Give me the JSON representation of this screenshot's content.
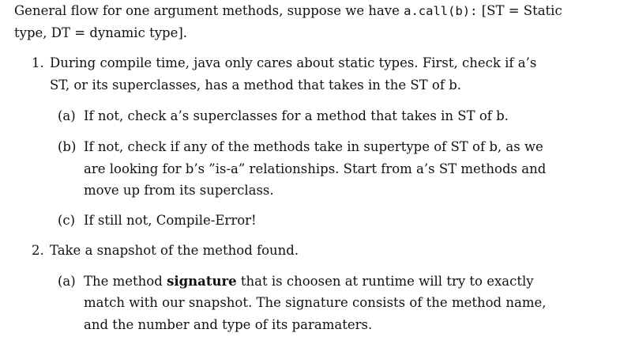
{
  "intro": {
    "line1_prefix": "General flow for one argument methods, suppose we have ",
    "line1_code": "a.call(b):",
    "line1_suffix": " [ST = Static",
    "line2": "type, DT = dynamic type]."
  },
  "items": [
    {
      "marker": "1.",
      "lines": [
        "During compile time, java only cares about static types. First, check if a’s",
        "ST, or its superclasses, has a method that takes in the ST of b."
      ],
      "subitems": [
        {
          "marker": "(a)",
          "lines": [
            "If not, check a’s superclasses for a method that takes in ST of b."
          ]
        },
        {
          "marker": "(b)",
          "lines": [
            "If not, check if any of the methods take in supertype of ST of b, as we",
            "are looking for b’s ”is-a” relationships. Start from a’s ST methods and",
            "move up from its superclass."
          ]
        },
        {
          "marker": "(c)",
          "lines": [
            "If still not, Compile-Error!"
          ]
        }
      ]
    },
    {
      "marker": "2.",
      "lines": [
        "Take a snapshot of the method found."
      ],
      "subitems": [
        {
          "marker": "(a)",
          "line1_prefix": "The method ",
          "line1_bold": "signature",
          "line1_suffix": " that is choosen at runtime will try to exactly",
          "lines": [
            "match with our snapshot. The signature consists of the method name,",
            "and the number and type of its paramaters."
          ]
        }
      ]
    }
  ]
}
